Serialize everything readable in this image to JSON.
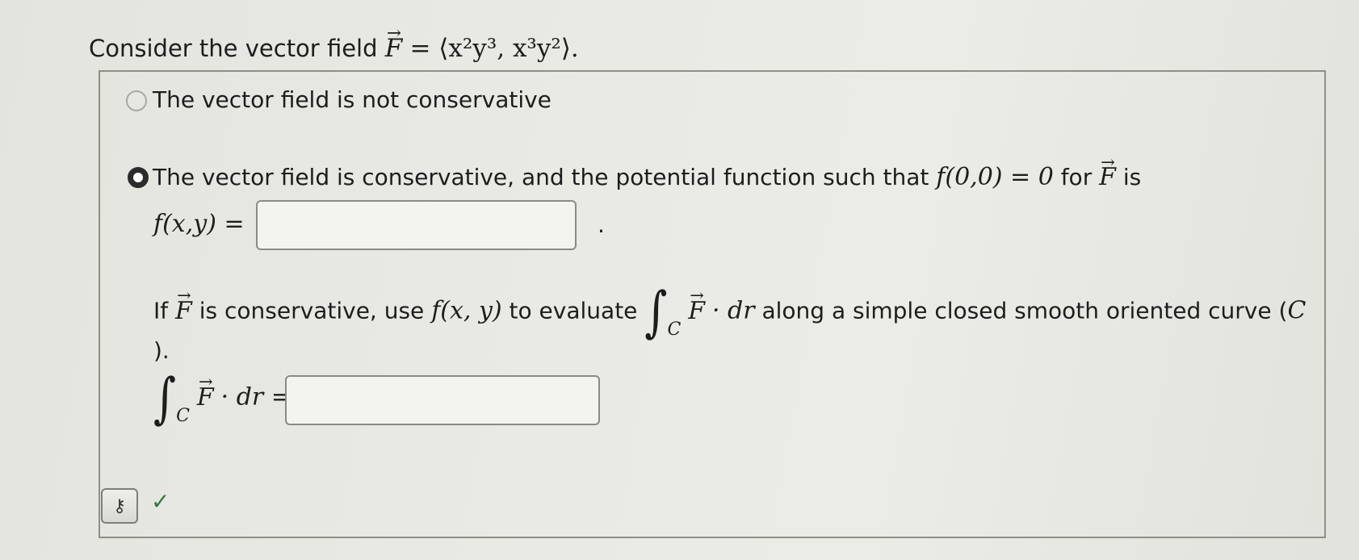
{
  "question": {
    "prefix": "Consider the vector field",
    "field_symbol": "F",
    "field_definition": "= ⟨x²y³, x³y²⟩."
  },
  "options": [
    {
      "label": "The vector field is not conservative",
      "selected": false
    },
    {
      "label_before": "The vector field is conservative, and the potential function such that",
      "condition": "f(0,0) = 0",
      "label_for": "for",
      "label_is": "is",
      "selected": true
    }
  ],
  "potential": {
    "lhs": "f(x,y) =",
    "value": "",
    "trailing": "."
  },
  "line_integral": {
    "text_if": "If",
    "text_conservative": "is conservative, use",
    "fxy": "f(x, y)",
    "text_evaluate": "to evaluate",
    "integrand": "· dr",
    "text_along": "along a simple closed smooth oriented curve (",
    "curve_letter": "C",
    "closing": ").",
    "answer_integrand": "· dr =",
    "answer_value": ""
  },
  "status": {
    "key_icon": "key-icon",
    "check_icon": "checkmark-icon",
    "check_color": "#2f7d3a"
  }
}
